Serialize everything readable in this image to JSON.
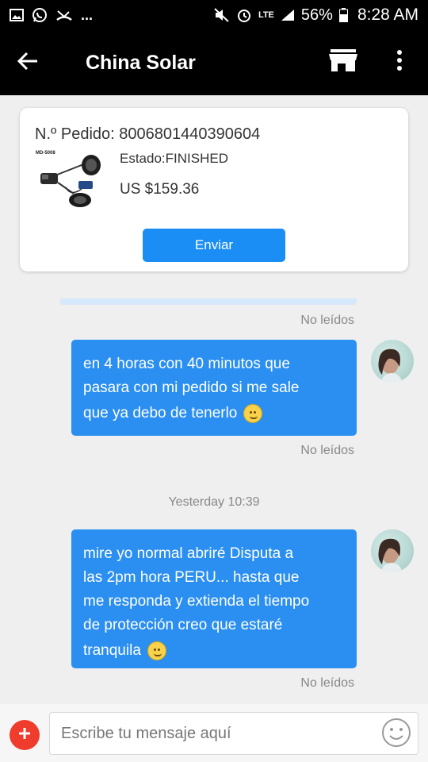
{
  "status_bar": {
    "battery_percent": "56%",
    "time": "8:28 AM",
    "network_label": "LTE",
    "notification_more": "..."
  },
  "toolbar": {
    "title": "China Solar",
    "icons": [
      "back-arrow-icon",
      "store-icon",
      "more-vertical-icon"
    ]
  },
  "order": {
    "number_label": "N.º Pedido: 8006801440390604",
    "status": "Estado:FINISHED",
    "price": "US $159.36",
    "thumb_label": "MD-5008",
    "send_label": "Enviar"
  },
  "messages": [
    {
      "read_status": "Nolmeídos"
    }
  ],
  "chat": {
    "read_status_top": "No leídos",
    "msg1_line1": "en 4 horas con 40 minutos que",
    "msg1_line2": "pasara con mi pedido si me sale",
    "msg1_line3": "que ya debo de tenerlo",
    "msg1_status": "No leídos",
    "timestamp": "Yesterday 10:39",
    "msg2_line1": "mire yo normal abriré Disputa a",
    "msg2_line2": "las 2pm hora PERU... hasta que",
    "msg2_line3": "me responda y extienda el tiempo",
    "msg2_line4": "de protección creo que  estaré",
    "msg2_line5": "tranquila",
    "msg2_status": "No leídos"
  },
  "composer": {
    "placeholder": "Escribe tu mensaje aquí"
  },
  "colors": {
    "accent": "#1a8ef5",
    "bubble": "#2a8ff0",
    "add_button": "#ef3c2c"
  }
}
